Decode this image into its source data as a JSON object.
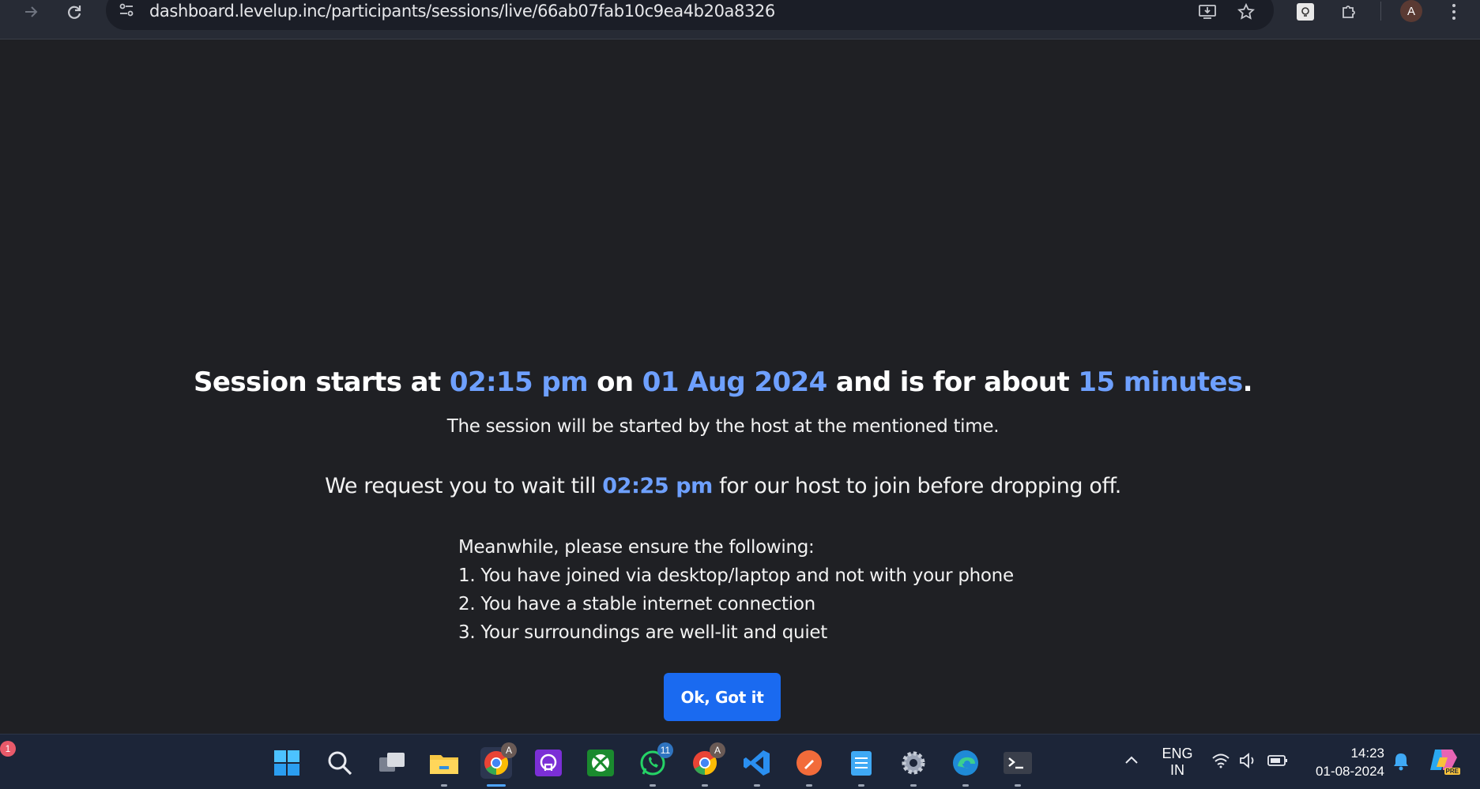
{
  "browser": {
    "url": "dashboard.levelup.inc/participants/sessions/live/66ab07fab10c9ea4b20a8326",
    "profile_initial": "A"
  },
  "session": {
    "headline_prefix": "Session starts at ",
    "start_time": "02:15 pm",
    "headline_on": " on ",
    "date": "01 Aug 2024",
    "headline_mid": " and is for about ",
    "duration": "15 minutes",
    "headline_end": ".",
    "subtitle": "The session will be started by the host at the mentioned time.",
    "request_prefix": "We request you to wait till ",
    "wait_time": "02:25 pm",
    "request_suffix": " for our host to join before dropping off.",
    "checklist_intro": "Meanwhile, please ensure the following:",
    "checklist": [
      "1. You have joined via desktop/laptop and not with your phone",
      "2. You have a stable internet connection",
      "3. Your surroundings are well-lit and quiet"
    ],
    "ok_label": "Ok, Got it"
  },
  "taskbar": {
    "widget_badge": "1",
    "chrome_profile_badge": "A",
    "whatsapp_badge": "11",
    "chrome2_profile_badge": "A",
    "lang_top": "ENG",
    "lang_bottom": "IN",
    "time": "14:23",
    "date": "01-08-2024",
    "copilot_badge": "PRE"
  },
  "colors": {
    "accent_text": "#6ea0ff",
    "button": "#1a6af0",
    "background": "#1f2024"
  }
}
